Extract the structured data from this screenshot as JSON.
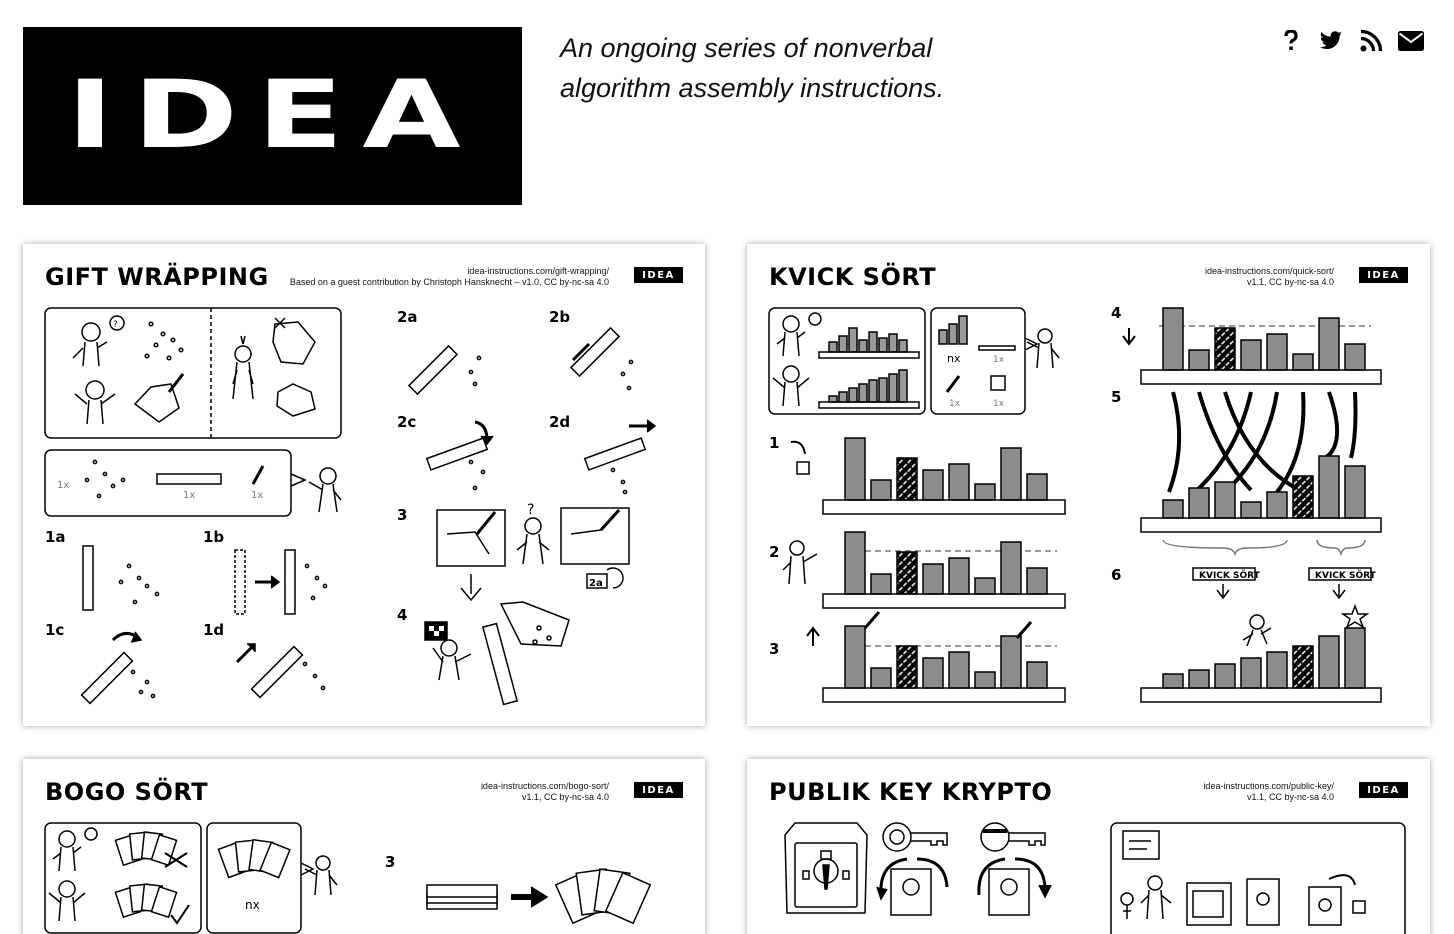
{
  "header": {
    "logo_text": "IDEA",
    "tagline_line1": "An ongoing series of nonverbal",
    "tagline_line2": "algorithm assembly instructions.",
    "icons": [
      "question-icon",
      "twitter-icon",
      "rss-icon",
      "email-icon"
    ]
  },
  "cards": [
    {
      "title": "GIFT WRÄPPING",
      "url": "idea-instructions.com/gift-wrapping/",
      "credit": "Based on a guest contribution by Christoph Hansknecht – v1.0, CC by-nc-sa 4.0",
      "badge": "IDEA",
      "steps": [
        "1a",
        "1b",
        "1c",
        "1d",
        "2a",
        "2b",
        "2c",
        "2d",
        "3",
        "4"
      ],
      "labels": {
        "count_1x_a": "1x",
        "count_1x_b": "1x",
        "count_1x_c": "1x",
        "ref_2a": "2a"
      }
    },
    {
      "title": "KVICK SÖRT",
      "url": "idea-instructions.com/quick-sort/",
      "credit": "v1.1, CC by-nc-sa 4.0",
      "badge": "IDEA",
      "steps": [
        "1",
        "2",
        "3",
        "4",
        "5",
        "6"
      ],
      "labels": {
        "nx": "nx",
        "count_1x_a": "1x",
        "count_1x_b": "1x",
        "count_1x_c": "1x",
        "sign_left": "KVICK SÖRT",
        "sign_right": "KVICK SÖRT"
      }
    },
    {
      "title": "BOGO SÖRT",
      "url": "idea-instructions.com/bogo-sort/",
      "credit": "v1.1, CC by-nc-sa 4.0",
      "badge": "IDEA",
      "steps": [
        "3"
      ],
      "labels": {
        "nx": "nx"
      }
    },
    {
      "title": "PUBLIK KEY KRYPTO",
      "url": "idea-instructions.com/public-key/",
      "credit": "v1.1, CC by-nc-sa 4.0",
      "badge": "IDEA"
    }
  ],
  "colors": {
    "ink": "#000000",
    "bar_fill": "#8c8c8c",
    "paper": "#ffffff"
  }
}
